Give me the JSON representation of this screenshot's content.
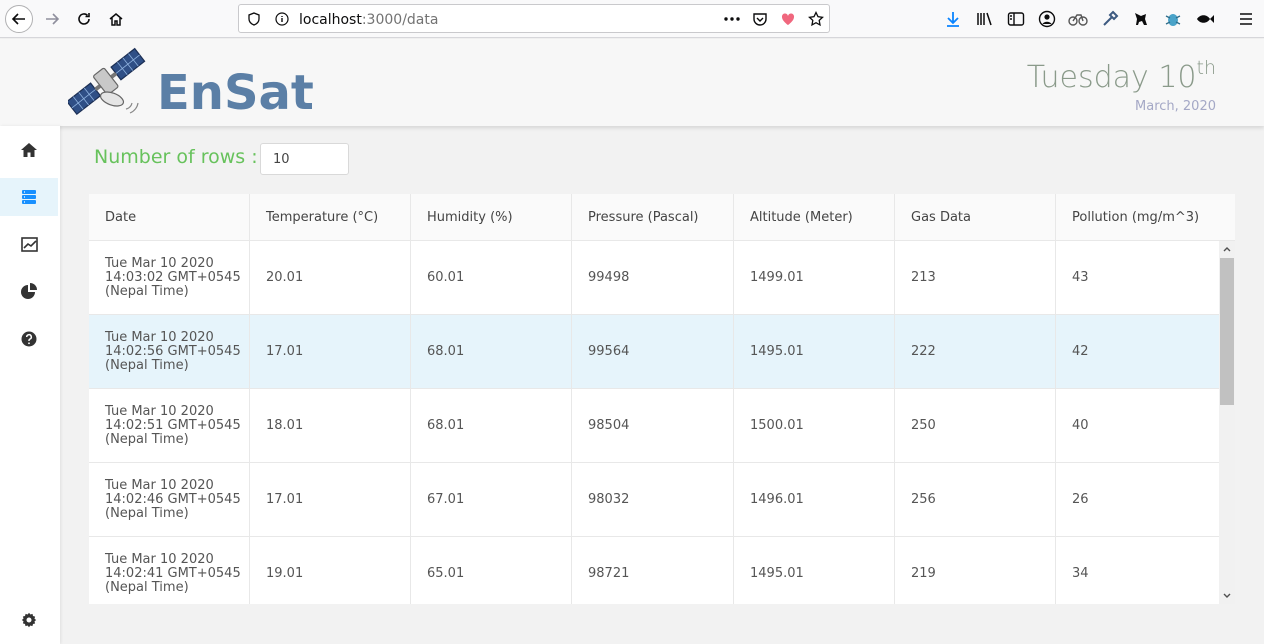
{
  "browser": {
    "url_host": "localhost",
    "url_path": ":3000/data"
  },
  "header": {
    "brand": "EnSat",
    "day": "Tuesday 10",
    "day_suffix": "th",
    "month": "March, 2020"
  },
  "sidebar": {
    "items": [
      "home-icon",
      "data-table-icon",
      "line-chart-icon",
      "pie-chart-icon",
      "help-icon",
      "settings-icon"
    ],
    "active": "data-table-icon"
  },
  "controls": {
    "rows_label": "Number of rows :",
    "rows_value": "10"
  },
  "table": {
    "columns": [
      "Date",
      "Temperature (°C)",
      "Humidity (%)",
      "Pressure (Pascal)",
      "Altitude (Meter)",
      "Gas Data",
      "Pollution (mg/m^3)"
    ],
    "rows": [
      {
        "date": "Tue Mar 10 2020\n14:03:02 GMT+0545\n(Nepal Time)",
        "temperature": "20.01",
        "humidity": "60.01",
        "pressure": "99498",
        "altitude": "1499.01",
        "gas": "213",
        "pollution": "43"
      },
      {
        "date": "Tue Mar 10 2020\n14:02:56 GMT+0545\n(Nepal Time)",
        "temperature": "17.01",
        "humidity": "68.01",
        "pressure": "99564",
        "altitude": "1495.01",
        "gas": "222",
        "pollution": "42"
      },
      {
        "date": "Tue Mar 10 2020\n14:02:51 GMT+0545\n(Nepal Time)",
        "temperature": "18.01",
        "humidity": "68.01",
        "pressure": "98504",
        "altitude": "1500.01",
        "gas": "250",
        "pollution": "40"
      },
      {
        "date": "Tue Mar 10 2020\n14:02:46 GMT+0545\n(Nepal Time)",
        "temperature": "17.01",
        "humidity": "67.01",
        "pressure": "98032",
        "altitude": "1496.01",
        "gas": "256",
        "pollution": "26"
      },
      {
        "date": "Tue Mar 10 2020\n14:02:41 GMT+0545\n(Nepal Time)",
        "temperature": "19.01",
        "humidity": "65.01",
        "pressure": "98721",
        "altitude": "1495.01",
        "gas": "219",
        "pollution": "34"
      }
    ],
    "highlighted_row": 1
  },
  "colors": {
    "brand": "#5b7fa6",
    "rows_label": "#67c25c",
    "active_nav": "#1890ff",
    "row_highlight": "#e6f4fb"
  }
}
